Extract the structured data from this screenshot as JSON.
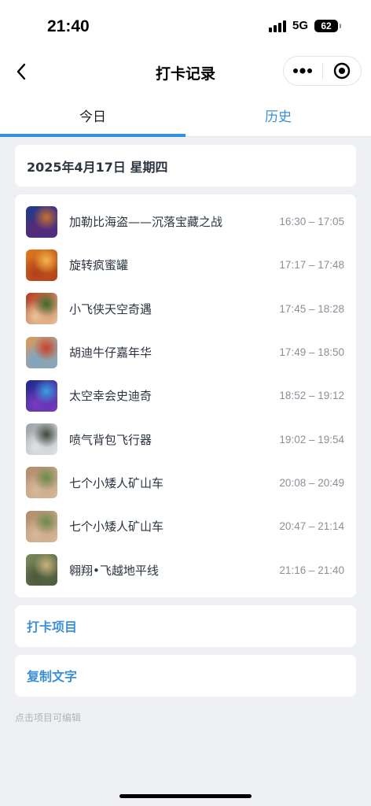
{
  "status": {
    "time": "21:40",
    "network": "5G",
    "battery": "62"
  },
  "nav": {
    "title": "打卡记录"
  },
  "tabs": [
    {
      "label": "今日",
      "active": true
    },
    {
      "label": "历史",
      "active": false
    }
  ],
  "date_header": "2025年4月17日 星期四",
  "records": [
    {
      "name": "加勒比海盗——沉落宝藏之战",
      "time": "16:30 – 17:05",
      "thumb": "pirates",
      "colors": [
        "#1f3b8a",
        "#c9702e",
        "#5a2a7a"
      ]
    },
    {
      "name": "旋转疯蜜罐",
      "time": "17:17 – 17:48",
      "thumb": "honeypot",
      "colors": [
        "#e07a1c",
        "#f2b84a",
        "#b0401c"
      ]
    },
    {
      "name": "小飞侠天空奇遇",
      "time": "17:45 – 18:28",
      "thumb": "peterpan",
      "colors": [
        "#b23a1e",
        "#3c6b2e",
        "#e8c49a"
      ]
    },
    {
      "name": "胡迪牛仔嘉年华",
      "time": "17:49 – 18:50",
      "thumb": "woody",
      "colors": [
        "#d99a5a",
        "#c8402a",
        "#7aa6c8"
      ]
    },
    {
      "name": "太空幸会史迪奇",
      "time": "18:52 – 19:12",
      "thumb": "stitch",
      "colors": [
        "#1a2a8a",
        "#39a0e0",
        "#7a3ac0"
      ]
    },
    {
      "name": "喷气背包飞行器",
      "time": "19:02 – 19:54",
      "thumb": "jetpack",
      "colors": [
        "#9aa0a6",
        "#3d4a3a",
        "#e0e2e4"
      ]
    },
    {
      "name": "七个小矮人矿山车",
      "time": "20:08 – 20:49",
      "thumb": "dwarfs",
      "colors": [
        "#b08a6a",
        "#6b8a4a",
        "#d8b89a"
      ]
    },
    {
      "name": "七个小矮人矿山车",
      "time": "20:47 – 21:14",
      "thumb": "dwarfs",
      "colors": [
        "#b08a6a",
        "#6b8a4a",
        "#d8b89a"
      ]
    },
    {
      "name": "翱翔•飞越地平线",
      "time": "21:16 – 21:40",
      "thumb": "soaring",
      "colors": [
        "#7a8a5a",
        "#c8b07a",
        "#4a5a3a"
      ]
    }
  ],
  "actions": {
    "checkin_items": "打卡项目",
    "copy_text": "复制文字"
  },
  "hint": "点击项目可编辑",
  "icons": {
    "back": "chevron-left-icon",
    "more": "more-dots-icon",
    "close": "target-close-icon"
  }
}
